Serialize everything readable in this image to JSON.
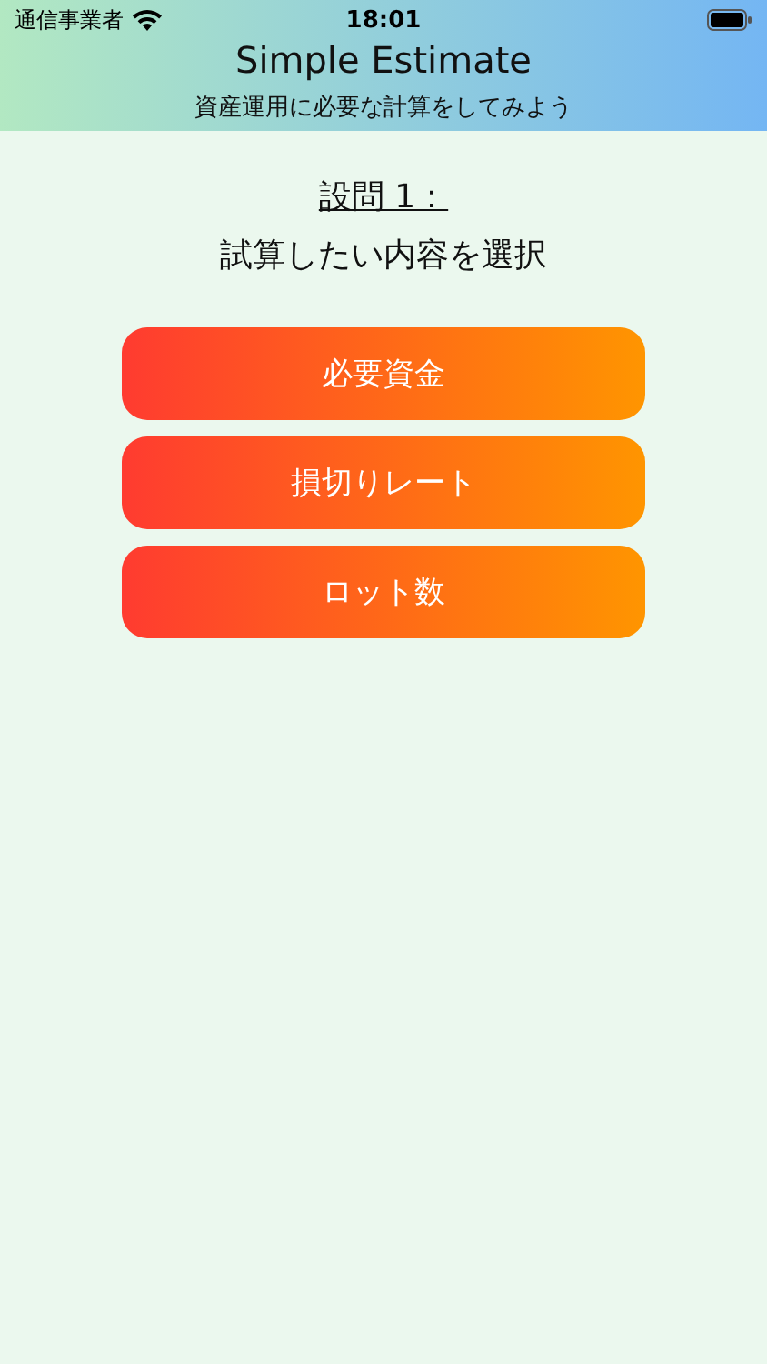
{
  "status_bar": {
    "carrier": "通信事業者",
    "time": "18:01"
  },
  "header": {
    "title": "Simple Estimate",
    "subtitle": "資産運用に必要な計算をしてみよう"
  },
  "question": {
    "label": "設問 1：",
    "prompt": "試算したい内容を選択"
  },
  "options": [
    {
      "label": "必要資金"
    },
    {
      "label": "損切りレート"
    },
    {
      "label": "ロット数"
    }
  ]
}
